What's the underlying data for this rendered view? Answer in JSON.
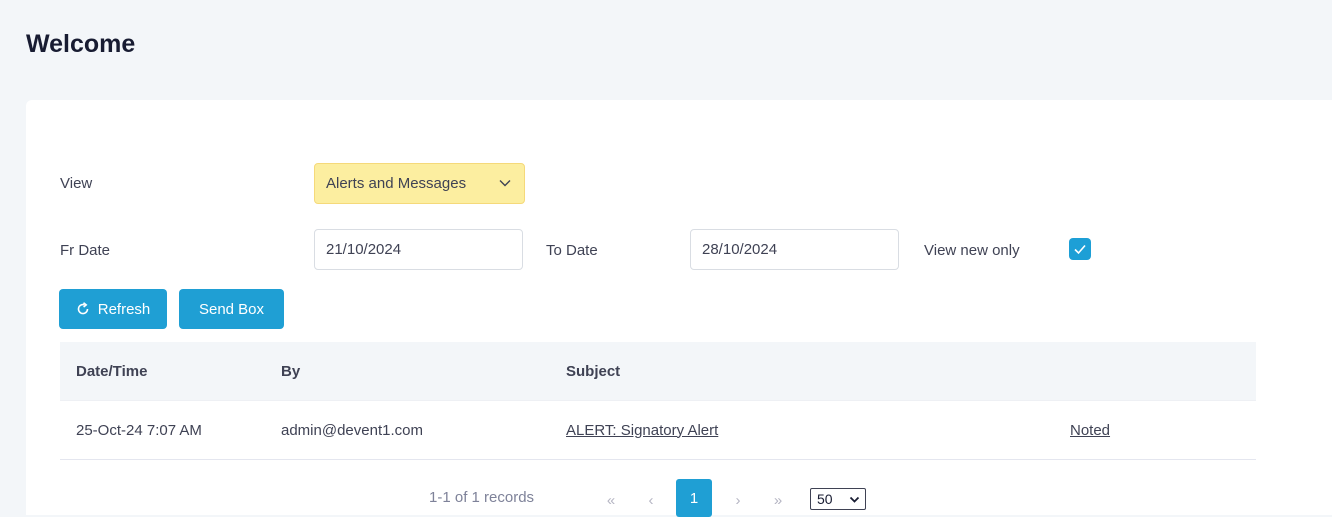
{
  "page": {
    "title": "Welcome"
  },
  "filters": {
    "view_label": "View",
    "view_value": "Alerts and Messages",
    "fr_date_label": "Fr Date",
    "fr_date_value": "21/10/2024",
    "to_date_label": "To Date",
    "to_date_value": "28/10/2024",
    "new_only_label": "View new only",
    "new_only_checked": true
  },
  "buttons": {
    "refresh": "Refresh",
    "send_box": "Send Box"
  },
  "table": {
    "headers": [
      "Date/Time",
      "By",
      "Subject",
      ""
    ],
    "rows": [
      {
        "datetime": "25-Oct-24 7:07 AM",
        "by": "admin@devent1.com",
        "subject": "ALERT: Signatory Alert",
        "action": "Noted"
      }
    ]
  },
  "pager": {
    "info": "1-1 of 1 records",
    "first": "«",
    "prev": "‹",
    "current": "1",
    "next": "›",
    "last": "»",
    "page_size": "50"
  },
  "colors": {
    "accent": "#1f9fd4",
    "select_bg": "#fceea0",
    "page_bg": "#f3f6f9"
  }
}
